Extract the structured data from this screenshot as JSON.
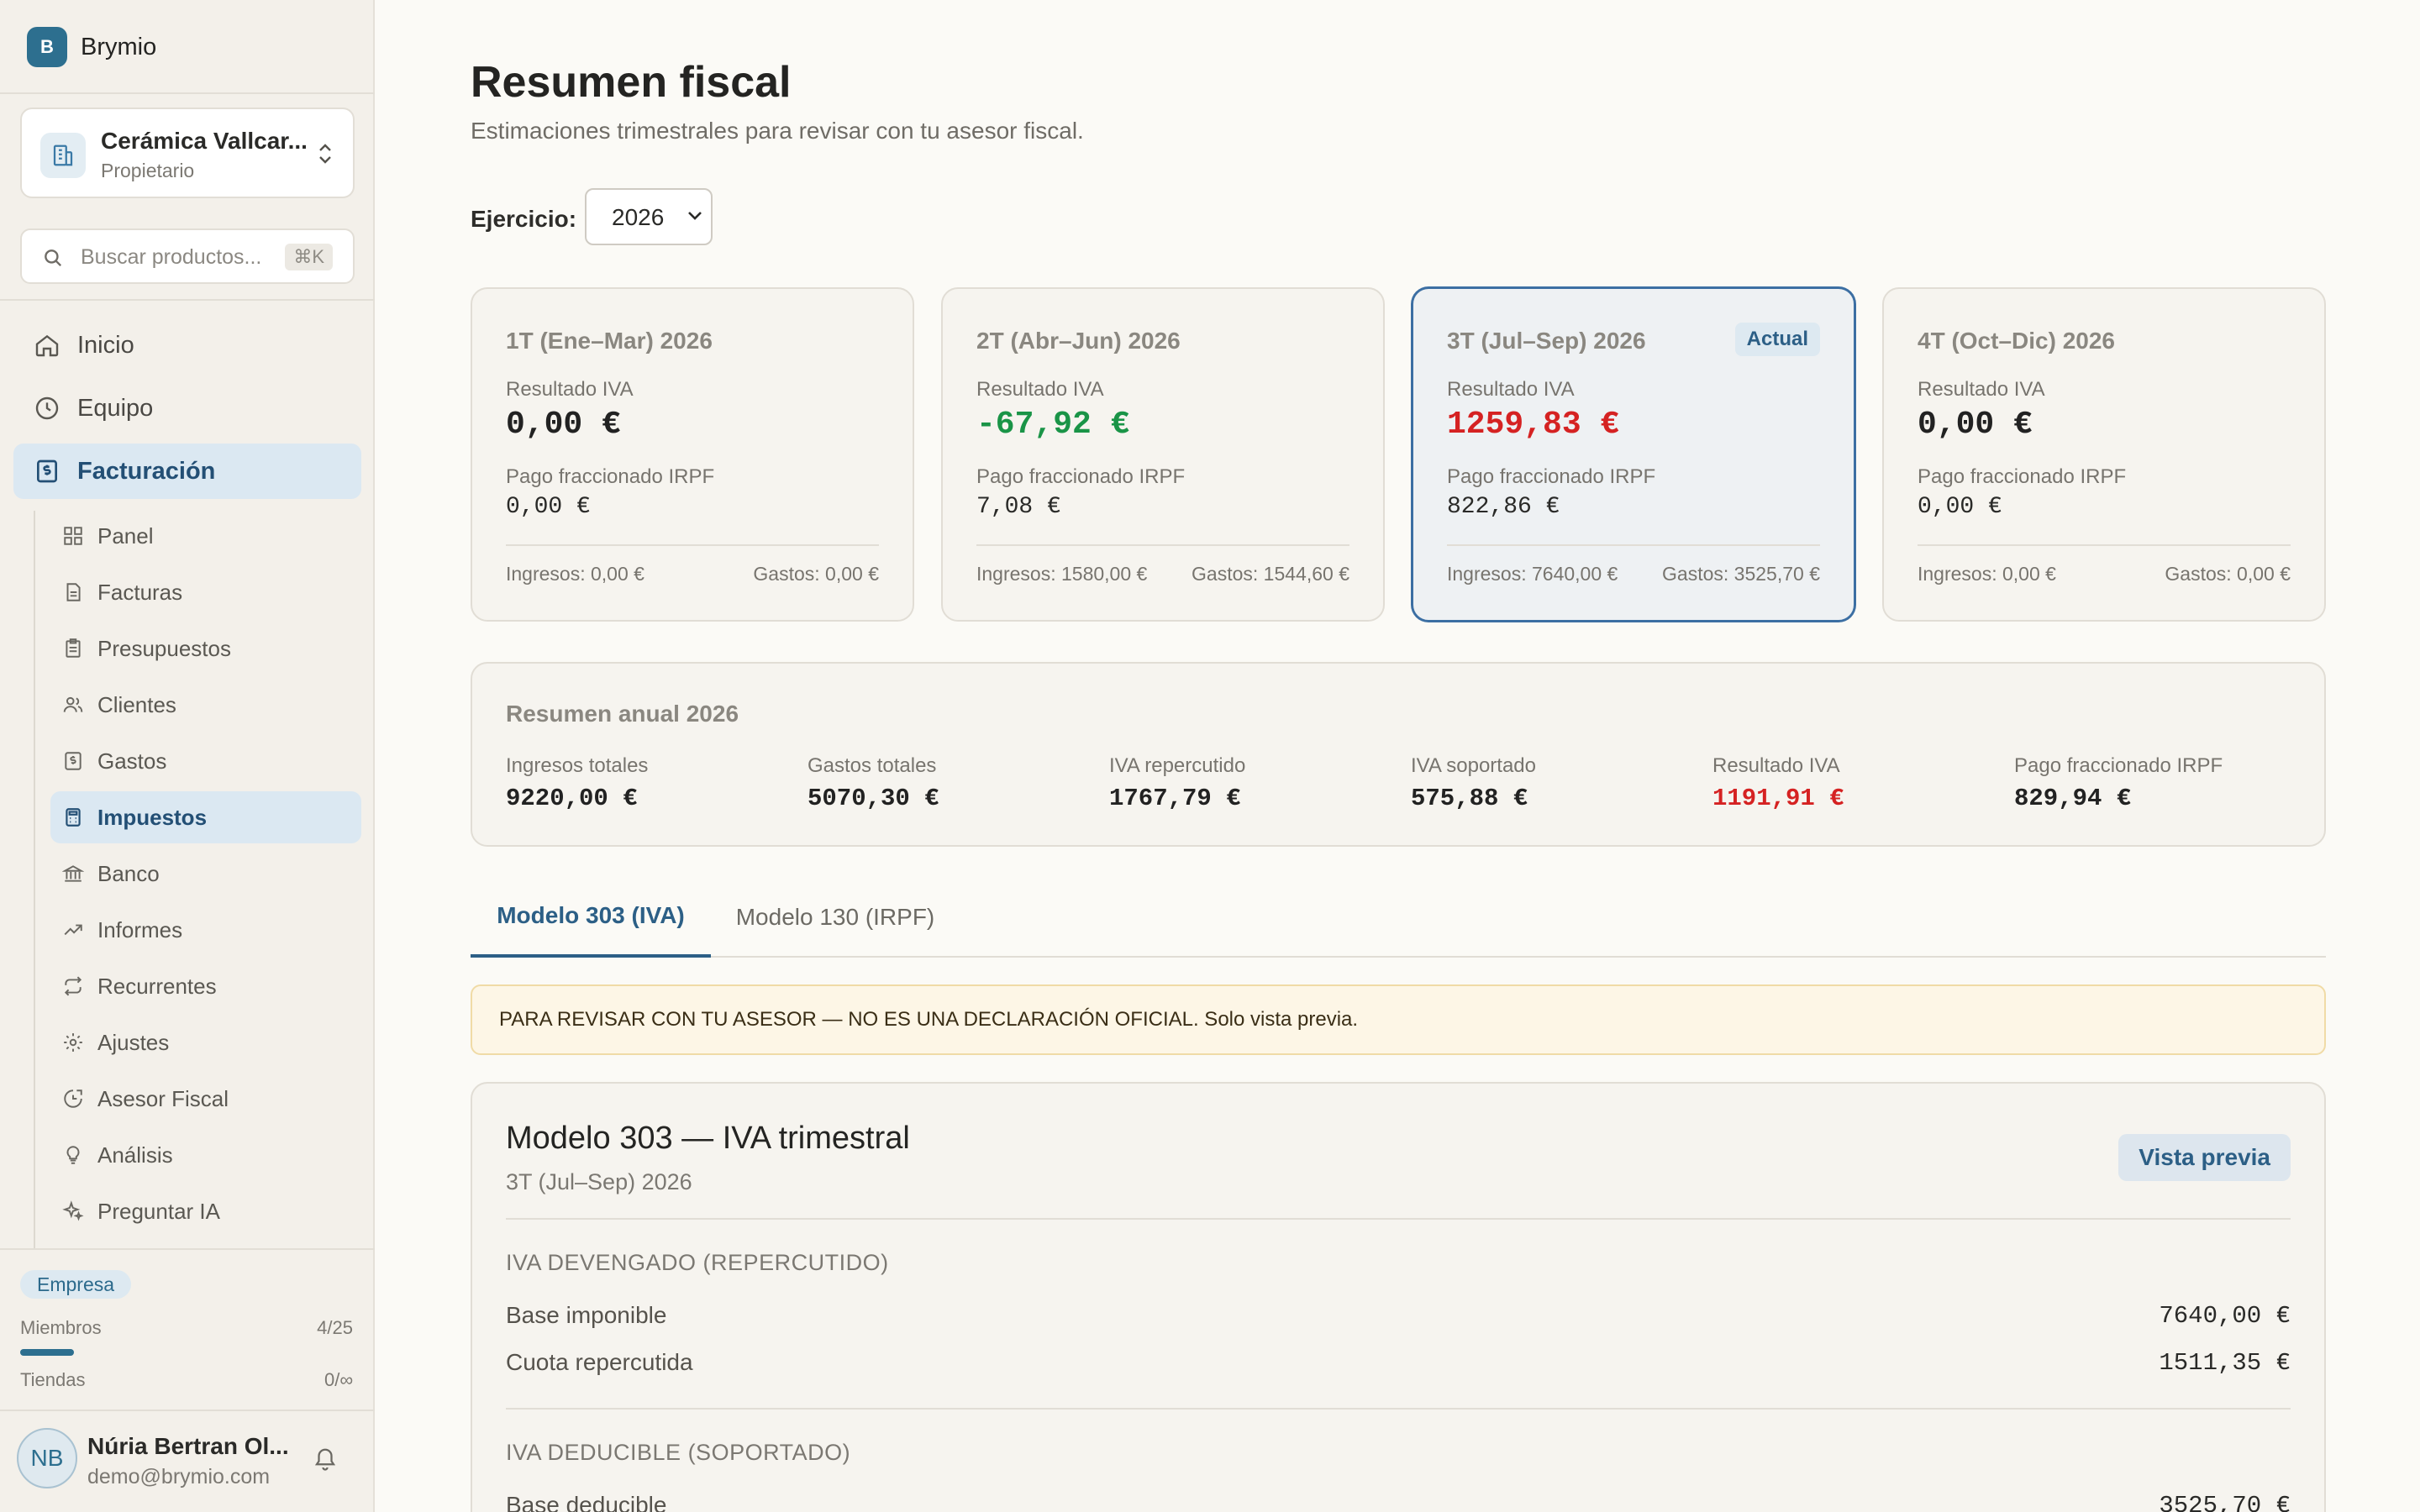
{
  "app": {
    "name": "Brymio",
    "logo_letter": "B"
  },
  "org": {
    "name": "Cerámica Vallcar...",
    "role": "Propietario"
  },
  "search": {
    "placeholder": "Buscar productos...",
    "shortcut": "⌘K"
  },
  "nav": {
    "main": [
      {
        "label": "Inicio",
        "icon": "home-icon"
      },
      {
        "label": "Equipo",
        "icon": "clock-icon"
      },
      {
        "label": "Facturación",
        "icon": "invoice-icon",
        "active": true
      }
    ],
    "sub": [
      {
        "label": "Panel",
        "icon": "grid-icon"
      },
      {
        "label": "Facturas",
        "icon": "document-icon"
      },
      {
        "label": "Presupuestos",
        "icon": "clipboard-icon"
      },
      {
        "label": "Clientes",
        "icon": "users-icon"
      },
      {
        "label": "Gastos",
        "icon": "receipt-icon"
      },
      {
        "label": "Impuestos",
        "icon": "calculator-icon",
        "active": true
      },
      {
        "label": "Banco",
        "icon": "bank-icon"
      },
      {
        "label": "Informes",
        "icon": "trend-icon"
      },
      {
        "label": "Recurrentes",
        "icon": "repeat-icon"
      },
      {
        "label": "Ajustes",
        "icon": "gear-icon"
      },
      {
        "label": "Asesor Fiscal",
        "icon": "advisor-icon"
      },
      {
        "label": "Análisis",
        "icon": "lightbulb-icon"
      },
      {
        "label": "Preguntar IA",
        "icon": "sparkles-icon"
      }
    ]
  },
  "plan": {
    "badge": "Empresa",
    "members_label": "Miembros",
    "members_value": "4/25",
    "members_fraction": 0.16,
    "stores_label": "Tiendas",
    "stores_value": "0/∞"
  },
  "user": {
    "initials": "NB",
    "name": "Núria Bertran Ol...",
    "email": "demo@brymio.com"
  },
  "page": {
    "title": "Resumen fiscal",
    "subtitle": "Estimaciones trimestrales para revisar con tu asesor fiscal.",
    "year_label": "Ejercicio:",
    "year_value": "2026"
  },
  "quarters": [
    {
      "title": "1T (Ene–Mar) 2026",
      "iva_label": "Resultado IVA",
      "iva_value": "0,00 €",
      "irpf_label": "Pago fraccionado IRPF",
      "irpf_value": "0,00 €",
      "income": "Ingresos: 0,00 €",
      "expenses": "Gastos: 0,00 €"
    },
    {
      "title": "2T (Abr–Jun) 2026",
      "iva_label": "Resultado IVA",
      "iva_value": "-67,92 €",
      "irpf_label": "Pago fraccionado IRPF",
      "irpf_value": "7,08 €",
      "income": "Ingresos: 1580,00 €",
      "expenses": "Gastos: 1544,60 €"
    },
    {
      "title": "3T (Jul–Sep) 2026",
      "badge": "Actual",
      "iva_label": "Resultado IVA",
      "iva_value": "1259,83 €",
      "irpf_label": "Pago fraccionado IRPF",
      "irpf_value": "822,86 €",
      "income": "Ingresos: 7640,00 €",
      "expenses": "Gastos: 3525,70 €"
    },
    {
      "title": "4T (Oct–Dic) 2026",
      "iva_label": "Resultado IVA",
      "iva_value": "0,00 €",
      "irpf_label": "Pago fraccionado IRPF",
      "irpf_value": "0,00 €",
      "income": "Ingresos: 0,00 €",
      "expenses": "Gastos: 0,00 €"
    }
  ],
  "annual": {
    "title": "Resumen anual 2026",
    "items": [
      {
        "label": "Ingresos totales",
        "value": "9220,00 €"
      },
      {
        "label": "Gastos totales",
        "value": "5070,30 €"
      },
      {
        "label": "IVA repercutido",
        "value": "1767,79 €"
      },
      {
        "label": "IVA soportado",
        "value": "575,88 €"
      },
      {
        "label": "Resultado IVA",
        "value": "1191,91 €"
      },
      {
        "label": "Pago fraccionado IRPF",
        "value": "829,94 €"
      }
    ]
  },
  "tabs": [
    {
      "label": "Modelo 303 (IVA)"
    },
    {
      "label": "Modelo 130 (IRPF)"
    }
  ],
  "warning": "PARA REVISAR CON TU ASESOR — NO ES UNA DECLARACIÓN OFICIAL. Solo vista previa.",
  "model303": {
    "title": "Modelo 303 — IVA trimestral",
    "period": "3T (Jul–Sep) 2026",
    "preview_button": "Vista previa",
    "section_devengado": "IVA DEVENGADO (REPERCUTIDO)",
    "base_label": "Base imponible",
    "base_value": "7640,00 €",
    "cuota_label": "Cuota repercutida",
    "cuota_value": "1511,35 €",
    "section_deducible": "IVA DEDUCIBLE (SOPORTADO)",
    "base_ded_label": "Base deducible",
    "base_ded_value": "3525,70 €"
  },
  "colors": {
    "accent": "#2c5f86",
    "positive": "#1a9447",
    "negative": "#d52222",
    "warning_bg": "#fdf6e6"
  }
}
